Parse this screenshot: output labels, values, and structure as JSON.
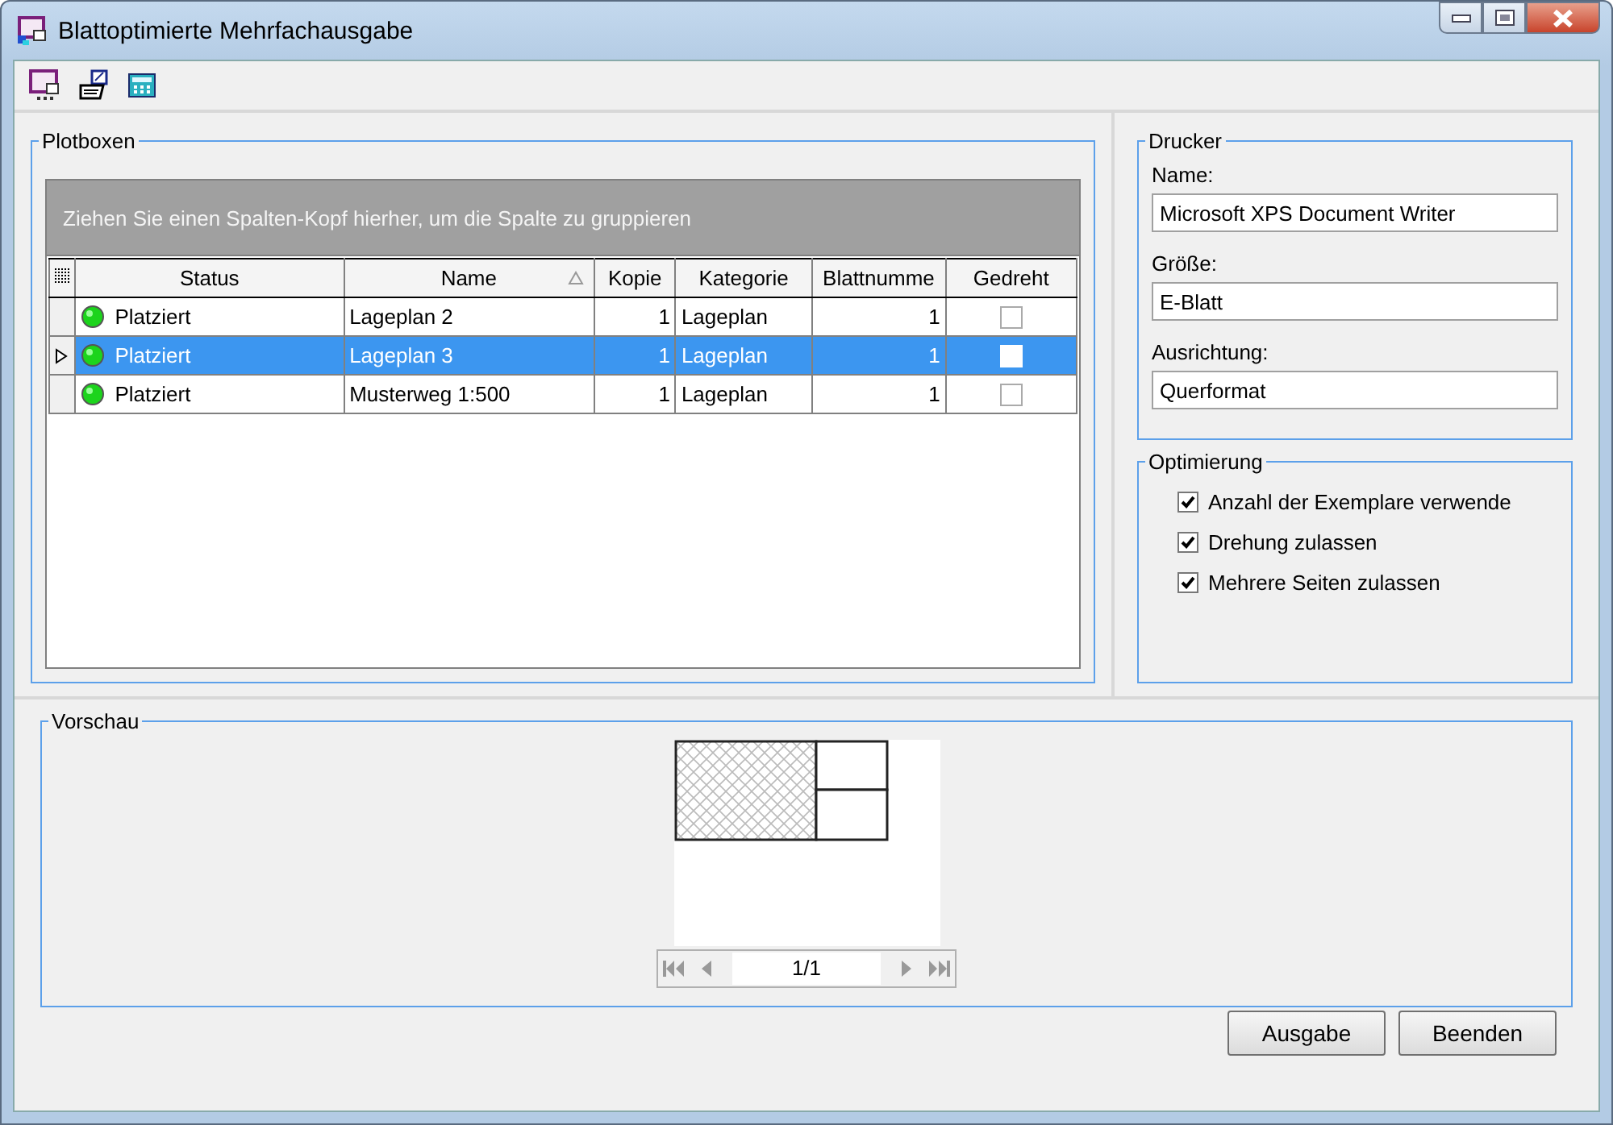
{
  "window": {
    "title": "Blattoptimierte Mehrfachausgabe"
  },
  "plotboxen": {
    "title": "Plotboxen",
    "group_hint": "Ziehen Sie einen Spalten-Kopf hierher, um die Spalte zu gruppieren",
    "columns": [
      {
        "label": "Status",
        "sorted": false
      },
      {
        "label": "Name",
        "sorted": true
      },
      {
        "label": "Kopie",
        "sorted": false
      },
      {
        "label": "Kategorie",
        "sorted": false
      },
      {
        "label": "Blattnumme",
        "sorted": false
      },
      {
        "label": "Gedreht",
        "sorted": false
      }
    ],
    "rows": [
      {
        "status": "Platziert",
        "name": "Lageplan 2",
        "kopie": "1",
        "kategorie": "Lageplan",
        "blattnummer": "1",
        "gedreht": false,
        "selected": false
      },
      {
        "status": "Platziert",
        "name": "Lageplan 3",
        "kopie": "1",
        "kategorie": "Lageplan",
        "blattnummer": "1",
        "gedreht": false,
        "selected": true
      },
      {
        "status": "Platziert",
        "name": "Musterweg 1:500",
        "kopie": "1",
        "kategorie": "Lageplan",
        "blattnummer": "1",
        "gedreht": false,
        "selected": false
      }
    ]
  },
  "drucker": {
    "title": "Drucker",
    "fields": [
      {
        "label": "Name:",
        "value": "Microsoft XPS Document Writer"
      },
      {
        "label": "Größe:",
        "value": "E-Blatt"
      },
      {
        "label": "Ausrichtung:",
        "value": "Querformat"
      }
    ]
  },
  "optimierung": {
    "title": "Optimierung",
    "options": [
      {
        "label": "Anzahl der Exemplare verwende",
        "checked": true
      },
      {
        "label": "Drehung zulassen",
        "checked": true
      },
      {
        "label": "Mehrere Seiten zulassen",
        "checked": true
      }
    ]
  },
  "vorschau": {
    "title": "Vorschau",
    "page": "1/1"
  },
  "buttons": [
    "Ausgabe",
    "Beenden"
  ]
}
